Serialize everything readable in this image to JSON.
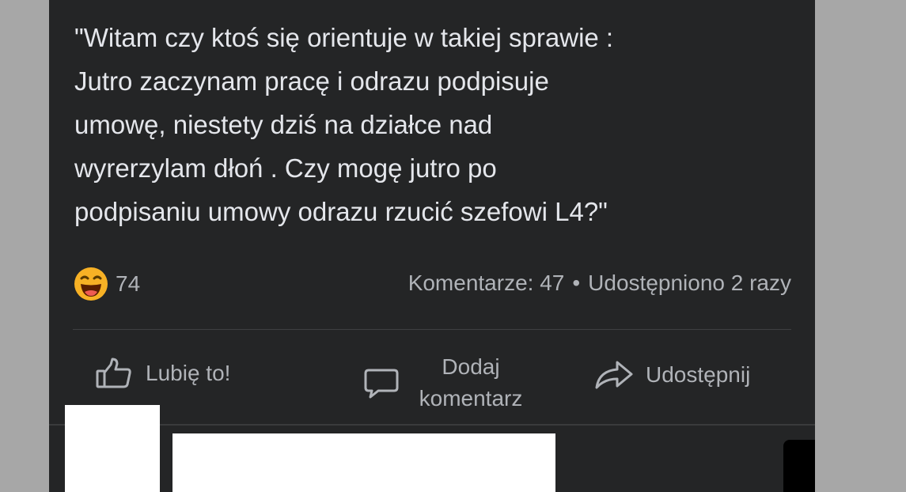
{
  "post": {
    "text": "\"Witam czy ktoś się orientuje w takiej sprawie :\nJutro zaczynam pracę i odrazu podpisuje\numowę, niestety dziś na działce nad\nwyrerzylam dłoń . Czy mogę jutro po\npodpisaniu umowy odrazu rzucić szefowi L4?\""
  },
  "stats": {
    "reaction_icon": "haha-emoji-icon",
    "reaction_count": "74",
    "comments": "Komentarze: 47",
    "separator": "•",
    "shares": "Udostępniono 2 razy"
  },
  "actions": {
    "like": {
      "icon": "thumbs-up-icon",
      "label": "Lubię to!"
    },
    "comment": {
      "icon": "comment-bubble-icon",
      "label": "Dodaj komentarz"
    },
    "share": {
      "icon": "share-arrow-icon",
      "label": "Udostępnij"
    }
  },
  "colors": {
    "background": "#a7a7a7",
    "card": "#242526",
    "text_primary": "#e4e6eb",
    "text_secondary": "#b0b3b8",
    "divider": "#3e4042"
  }
}
